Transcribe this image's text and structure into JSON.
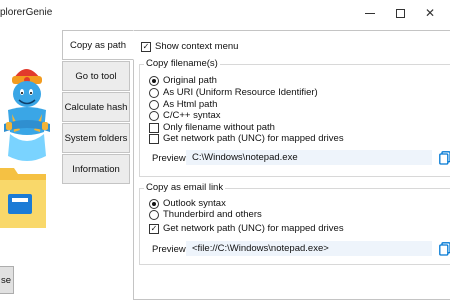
{
  "window": {
    "title": "plorerGenie",
    "controls": {
      "minimize": "minimize",
      "maximize": "maximize",
      "close": "✕"
    }
  },
  "tabs": [
    {
      "label": "Copy as path",
      "active": true
    },
    {
      "label": "Go to tool"
    },
    {
      "label": "Calculate hash"
    },
    {
      "label": "System folders"
    },
    {
      "label": "Information"
    }
  ],
  "panel": {
    "show_context_menu": {
      "label": "Show context menu",
      "checked": true
    },
    "copy_filename": {
      "title": "Copy filename(s)",
      "radios": [
        {
          "label": "Original path",
          "selected": true
        },
        {
          "label": "As URI (Uniform Resource Identifier)"
        },
        {
          "label": "As Html path"
        },
        {
          "label": "C/C++ syntax"
        }
      ],
      "checks": [
        {
          "label": "Only filename without path",
          "checked": false
        },
        {
          "label": "Get network path (UNC) for mapped drives",
          "checked": false
        }
      ],
      "preview_label": "Preview",
      "preview_value": "C:\\Windows\\notepad.exe"
    },
    "email_link": {
      "title": "Copy as email link",
      "radios": [
        {
          "label": "Outlook syntax",
          "selected": true
        },
        {
          "label": "Thunderbird and others"
        }
      ],
      "checks": [
        {
          "label": "Get network path (UNC) for mapped drives",
          "checked": true
        }
      ],
      "preview_label": "Preview",
      "preview_value": "<file://C:\\Windows\\notepad.exe>"
    }
  },
  "footer": {
    "close_label": "se"
  },
  "colors": {
    "accent": "#0078d4",
    "preview_bg": "#eef4fb",
    "tab_bg": "#ececec"
  }
}
